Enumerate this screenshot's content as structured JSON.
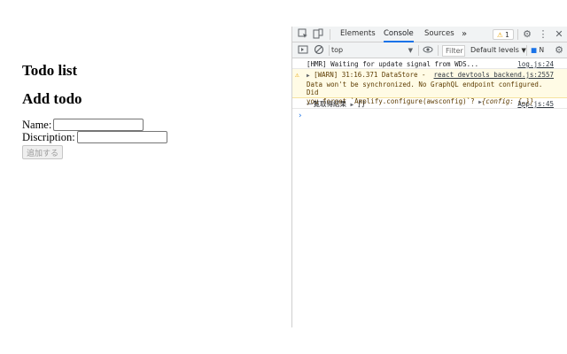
{
  "app": {
    "title": "Todo list",
    "subtitle": "Add todo",
    "name_label": "Name:",
    "name_value": "",
    "description_label": "Discription:",
    "description_value": "",
    "add_button_label": "追加する"
  },
  "devtools": {
    "tabs": [
      {
        "label": "Elements",
        "active": false
      },
      {
        "label": "Console",
        "active": true
      },
      {
        "label": "Sources",
        "active": false
      }
    ],
    "more_tabs_glyph": "»",
    "warning_count": "1",
    "context": "top",
    "filter_placeholder": "Filter",
    "levels_label": "Default levels",
    "issues_label": "N",
    "messages": [
      {
        "text": "[HMR] Waiting for update signal from WDS...",
        "source": "log.js:24",
        "level": "log"
      },
      {
        "line1": "[WARN] 31:16.371 DataStore -",
        "line2": "Data won't be synchronized. No GraphQL endpoint configured. Did",
        "line3": "you forget `Amplify.configure(awsconfig)`?",
        "obj": "{config: {…}}",
        "source": "react_devtools_backend.js:2557",
        "level": "warning"
      },
      {
        "text": "一覧取得結果",
        "obj": "[]",
        "source": "App.js:45",
        "level": "log"
      }
    ],
    "prompt": "›"
  },
  "colors": {
    "accent": "#1a73e8",
    "warning_bg": "#fffbe5",
    "warning_icon": "#e6a100"
  }
}
